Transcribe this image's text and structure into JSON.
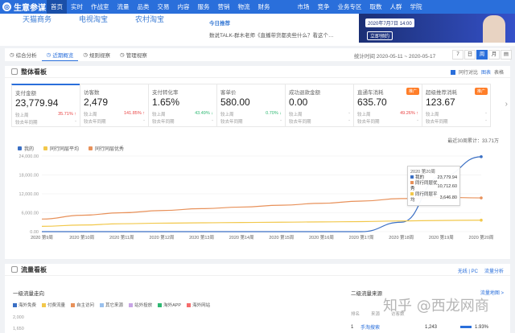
{
  "app": {
    "name": "生意参谋"
  },
  "nav": {
    "items": [
      "首页",
      "实时",
      "作战室",
      "流量",
      "品类",
      "交易",
      "内容",
      "服务",
      "营销",
      "物流",
      "财务",
      "市场",
      "竞争",
      "业务专区",
      "取数",
      "人群",
      "学院"
    ],
    "active_index": 0
  },
  "banner": {
    "tabs": [
      "天猫商务",
      "电视淘宝",
      "农村淘宝"
    ],
    "news_title": "今日推荐",
    "news_text": "数说TALK-群木老师《直播带货都卖些什么？看这个…",
    "ad_date": "2020年7月7日 14:00",
    "ad_button": "立即预约"
  },
  "filterbar": {
    "tabs": [
      "综合分析",
      "近期概览",
      "规则视察",
      "管理视察"
    ],
    "active_index": 1,
    "range_label": "统计时间 2020-05-11 ~ 2020-05-17",
    "period_buttons": [
      "7",
      "日",
      "周",
      "月"
    ],
    "active_period": 2
  },
  "overview": {
    "title": "整体看板",
    "options": [
      "同行对比",
      "图表",
      "表格"
    ],
    "cards": [
      {
        "label": "支付金额",
        "value": "23,779.94",
        "compare_label": "较上周",
        "compare_value": "35.71%",
        "trend": "up",
        "peer_label": "较去年同期",
        "peer_value": "-"
      },
      {
        "label": "访客数",
        "value": "2,479",
        "compare_label": "较上周",
        "compare_value": "141.85%",
        "trend": "up",
        "peer_label": "较去年同期",
        "peer_value": "-"
      },
      {
        "label": "支付转化率",
        "value": "1.65%",
        "compare_label": "较上周",
        "compare_value": "43.49%",
        "trend": "down",
        "peer_label": "较去年同期",
        "peer_value": "-"
      },
      {
        "label": "客单价",
        "value": "580.00",
        "compare_label": "较上周",
        "compare_value": "0.70%",
        "trend": "down",
        "peer_label": "较去年同期",
        "peer_value": "-"
      },
      {
        "label": "成功退款金额",
        "value": "0.00",
        "compare_label": "较上周",
        "compare_value": "-",
        "trend": "none",
        "peer_label": "较去年同期",
        "peer_value": "-"
      },
      {
        "label": "直通车消耗",
        "value": "635.70",
        "compare_label": "较上周",
        "compare_value": "49.26%",
        "trend": "up",
        "peer_label": "较去年同期",
        "peer_value": "-",
        "tag": "推广"
      },
      {
        "label": "超级推荐消耗",
        "value": "123.67",
        "compare_label": "较上周",
        "compare_value": "-",
        "trend": "none",
        "peer_label": "较去年同期",
        "peer_value": "-",
        "tag": "推广"
      }
    ],
    "chart_note": "最近30周累计：33.71万",
    "legend": [
      "我的",
      "同行同层平均",
      "同行同层优秀"
    ],
    "tooltip": {
      "title": "2020 第20周",
      "rows": [
        {
          "name": "我的",
          "value": "23,779.94"
        },
        {
          "name": "同行同层优秀",
          "value": "10,712.60"
        },
        {
          "name": "同行同层平均",
          "value": "3,646.80"
        }
      ]
    }
  },
  "chart_data": {
    "type": "line",
    "title": "",
    "xlabel": "",
    "ylabel": "",
    "x": [
      "2020 第9周",
      "2020 第10周",
      "2020 第11周",
      "2020 第12周",
      "2020 第13周",
      "2020 第14周",
      "2020 第15周",
      "2020 第16周",
      "2020 第17周",
      "2020 第18周",
      "2020 第19周",
      "2020 第20周"
    ],
    "ylim": [
      0,
      24000
    ],
    "yticks": [
      "0.00",
      "6,000.00",
      "12,000.00",
      "18,000.00",
      "24,000.00"
    ],
    "series": [
      {
        "name": "我的",
        "color": "#3a6fc4",
        "values": [
          0,
          0,
          0,
          0,
          0,
          0,
          0,
          0,
          0,
          3000,
          17500,
          23779.94
        ]
      },
      {
        "name": "同行同层平均",
        "color": "#f2c84b",
        "values": [
          1700,
          2100,
          2500,
          2700,
          2800,
          2900,
          3000,
          3100,
          3200,
          3400,
          3550,
          3646.8
        ]
      },
      {
        "name": "同行同层优秀",
        "color": "#e8915a",
        "values": [
          4000,
          5200,
          6000,
          6700,
          7300,
          7800,
          8400,
          9000,
          9700,
          10500,
          10900,
          10712.6
        ]
      }
    ],
    "grid": true,
    "legend_position": "top-left"
  },
  "traffic": {
    "title": "流量看板",
    "options": [
      "无线 | PC",
      "流量分析"
    ],
    "subtitle": "一级流量走向",
    "legend": [
      "海外免费",
      "付费流量",
      "自主访问",
      "其它来源",
      "站外投放",
      "淘外APP",
      "海外网站"
    ],
    "legend_colors": [
      "#3a6fc4",
      "#f2c84b",
      "#e8915a",
      "#9ac1ee",
      "#c8a5e6",
      "#2eb872",
      "#f56c6c"
    ],
    "axis_values": [
      "2,000",
      "1,650"
    ],
    "secondary_title": "二级流量来源",
    "secondary_more": "流量地图 >",
    "table_headers": [
      "排名",
      "来源",
      "访客数"
    ],
    "rows": [
      {
        "rank": "1",
        "source": "手淘搜索",
        "visitors": "1,243",
        "share": "1.93%"
      }
    ]
  },
  "watermark": "知乎 @西龙网商"
}
